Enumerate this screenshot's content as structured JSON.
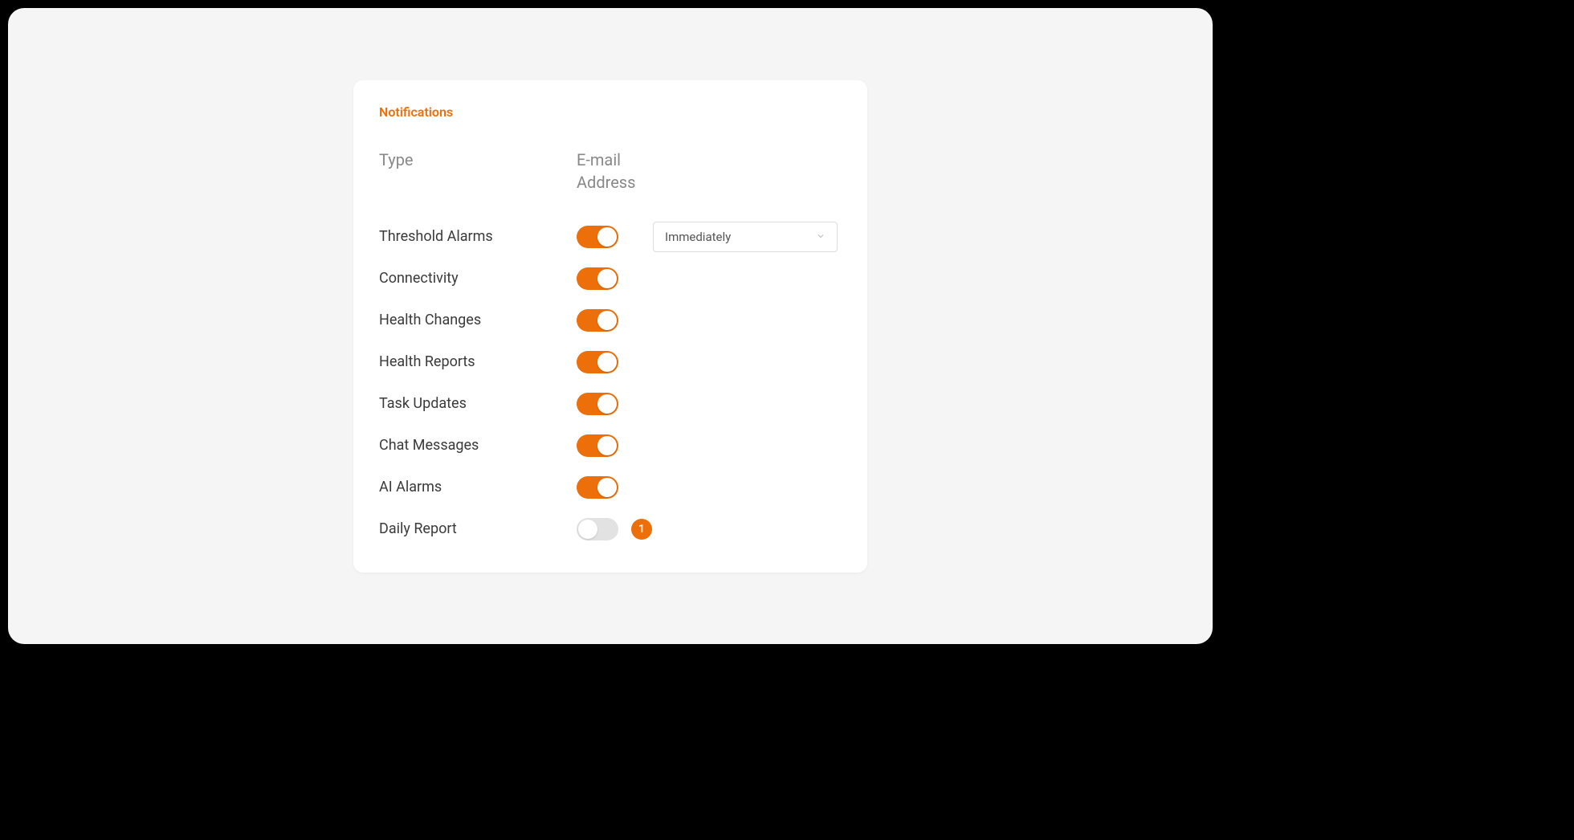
{
  "panel": {
    "title": "Notifications",
    "columns": {
      "type": "Type",
      "email": "E-mail Address"
    },
    "rows": [
      {
        "label": "Threshold Alarms",
        "enabled": true,
        "select": "Immediately"
      },
      {
        "label": "Connectivity",
        "enabled": true
      },
      {
        "label": "Health Changes",
        "enabled": true
      },
      {
        "label": "Health Reports",
        "enabled": true
      },
      {
        "label": "Task Updates",
        "enabled": true
      },
      {
        "label": "Chat Messages",
        "enabled": true
      },
      {
        "label": "AI Alarms",
        "enabled": true
      },
      {
        "label": "Daily Report",
        "enabled": false,
        "badge": "1"
      }
    ]
  }
}
